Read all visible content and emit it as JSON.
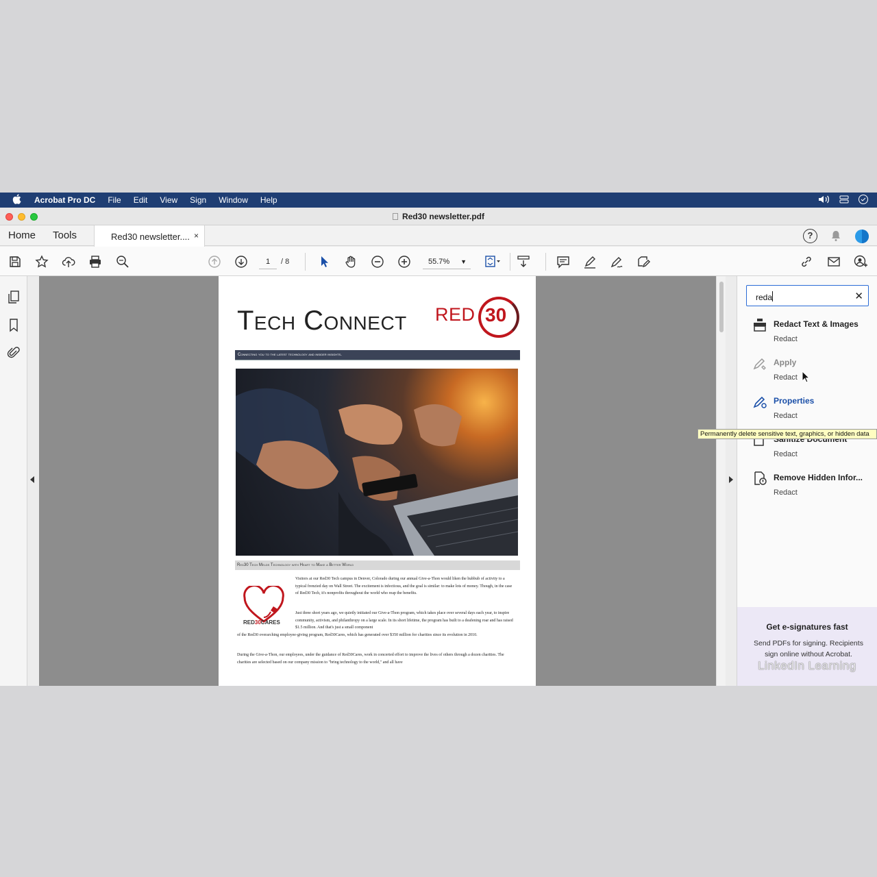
{
  "menubar": {
    "app_name": "Acrobat Pro DC",
    "items": [
      "File",
      "Edit",
      "View",
      "Sign",
      "Window",
      "Help"
    ]
  },
  "window": {
    "title": "Red30 newsletter.pdf"
  },
  "tabs": {
    "home": "Home",
    "tools": "Tools",
    "document": "Red30 newsletter....",
    "close": "×"
  },
  "toolbar": {
    "current_page": "1",
    "total_pages": "/ 8",
    "zoom": "55.7%"
  },
  "document": {
    "title": "Tech Connect",
    "logo_text": "RED",
    "logo_number": "30",
    "banner": "Connecting you to the latest technology and insider insights.",
    "caption": "Red30 Tech Melds Technology with Heart to Make a Better World",
    "cares_label_prefix": "RED",
    "cares_label_number": "30",
    "cares_label_suffix": "CARES",
    "para1": "Visitors at our Red30 Tech campus in Denver, Colorado during our annual Give-a-Thon would liken the hubbub of activity to a typical frenzied day on Wall Street. The excitement is infectious, and the goal is similar: to make lots of money. Though, in the case of Red30 Tech, it's nonprofits throughout the world who reap the benefits.",
    "para2": "Just three short years ago, we quietly initiated our Give-a-Thon program, which takes place over several days each year, to inspire community, activism, and philanthropy on a large scale. In its short lifetime, the program has built to a deafening roar and has raised $1.5 million. And that's just a small component",
    "para2b": "of the Red30 overarching employee-giving program, Red30Cares, which has generated over $350 million for charities since its evolution in 2010.",
    "para3": "During the Give-a-Thon, our employees, under the guidance of Red30Cares, work in concerted effort to improve the lives of others through a dozen charities. The charities are selected based on our company mission to \"bring technology to the world,\" and all have"
  },
  "search": {
    "value": "reda",
    "clear": "✕"
  },
  "results": [
    {
      "title": "Redact Text & Images",
      "sub": "Redact",
      "color": "#222222"
    },
    {
      "title": "Apply",
      "sub": "Redact",
      "color": "#888888"
    },
    {
      "title": "Properties",
      "sub": "Redact",
      "color": "#1a4fa8"
    },
    {
      "title": "Sanitize Document",
      "sub": "Redact",
      "color": "#222222"
    },
    {
      "title": "Remove Hidden Infor...",
      "sub": "Redact",
      "color": "#222222"
    }
  ],
  "tooltip": "Permanently delete sensitive text, graphics, or hidden data",
  "promo": {
    "title": "Get e-signatures fast",
    "text": "Send PDFs for signing. Recipients sign online without Acrobat."
  },
  "watermark": "LinkedIn Learning",
  "colors": {
    "menubar": "#1f3e73",
    "accent_blue": "#1a4fa8",
    "brand_red": "#c0161d"
  }
}
